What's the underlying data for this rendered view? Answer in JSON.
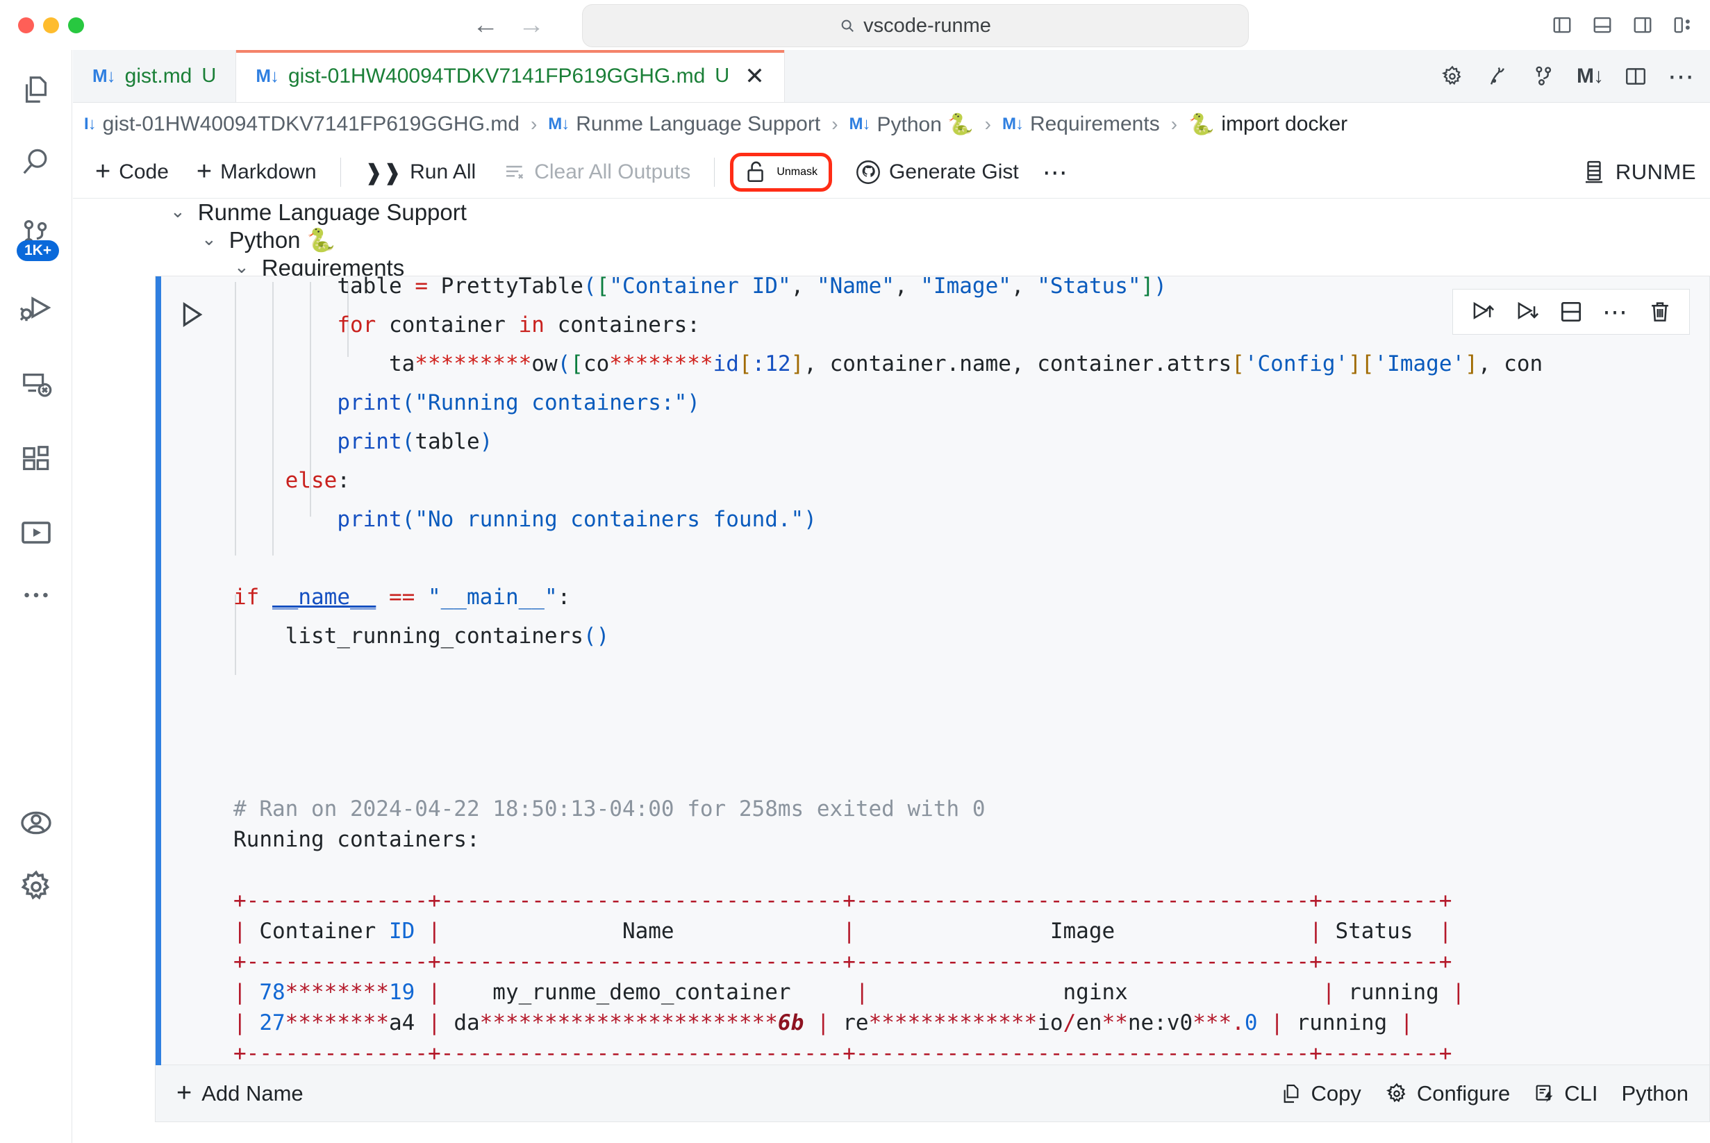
{
  "titlebar": {
    "omnibox_text": "vscode-runme",
    "back_label": "←",
    "forward_label": "→",
    "traffic": [
      "close",
      "minimize",
      "zoom"
    ],
    "layout_icons": [
      "toggle-primary-sidebar-icon",
      "toggle-panel-icon",
      "toggle-secondary-sidebar-icon",
      "customize-layout-icon"
    ]
  },
  "activitybar": {
    "items": [
      {
        "name": "explorer",
        "icon": "files-icon"
      },
      {
        "name": "search",
        "icon": "search-icon"
      },
      {
        "name": "source-control",
        "icon": "source-control-icon",
        "badge": "1K+"
      },
      {
        "name": "run-and-debug",
        "icon": "run-debug-icon"
      },
      {
        "name": "remote-explorer",
        "icon": "remote-explorer-icon"
      },
      {
        "name": "extensions",
        "icon": "extensions-icon"
      },
      {
        "name": "runme",
        "icon": "runme-play-icon"
      },
      {
        "name": "more-views",
        "icon": "ellipsis-icon"
      },
      {
        "name": "accounts",
        "icon": "account-icon"
      },
      {
        "name": "manage-settings",
        "icon": "gear-icon"
      }
    ]
  },
  "tabs": [
    {
      "label": "gist.md",
      "badge": "U",
      "icon": "markdown-icon",
      "active": false,
      "closable": false
    },
    {
      "label": "gist-01HW40094TDKV7141FP619GGHG.md",
      "badge": "U",
      "icon": "markdown-icon",
      "active": true,
      "closable": true
    }
  ],
  "tab_actions": [
    {
      "name": "settings-gear-icon"
    },
    {
      "name": "runme-mascot-icon"
    },
    {
      "name": "git-branch-icon"
    },
    {
      "name": "markdown-preview-icon"
    },
    {
      "name": "split-editor-icon"
    },
    {
      "name": "more-actions-icon"
    }
  ],
  "breadcrumb": {
    "items": [
      {
        "label": "gist-01HW40094TDKV7141FP619GGHG.md",
        "icon": "markdown-icon"
      },
      {
        "label": "Runme Language Support",
        "icon": "markdown-icon"
      },
      {
        "label": "Python 🐍",
        "icon": "markdown-icon"
      },
      {
        "label": "Requirements",
        "icon": "markdown-icon"
      },
      {
        "label": "import docker",
        "icon": "python-icon"
      }
    ],
    "separator": "›"
  },
  "notebook_toolbar": {
    "code_label": "Code",
    "markdown_label": "Markdown",
    "run_all_label": "Run All",
    "clear_all_outputs_label": "Clear All Outputs",
    "unmask_label": "Unmask",
    "unmask_highlighted": true,
    "generate_gist_label": "Generate Gist",
    "more_label": "⋯",
    "runme_label": "RUNME",
    "highlight_color": "#ff2d16"
  },
  "outline": {
    "h1": "Runme Language Support",
    "h2": "Python 🐍",
    "h3": "Requirements"
  },
  "cell": {
    "toolbar_icons": [
      "execute-above-icon",
      "execute-below-icon",
      "split-cell-icon",
      "more-cell-actions-icon",
      "delete-cell-icon"
    ],
    "run_icon": "run-cell-icon",
    "execution_brackets": "[ ]",
    "code_lines": [
      "table = PrettyTable([\"Container ID\", \"Name\", \"Image\", \"Status\"])",
      "        for container in containers:",
      "            ta*********ow([co********id[:12], container.name, container.attrs['Config']['Image'], con",
      "        print(\"Running containers:\")",
      "        print(table)",
      "    else:",
      "        print(\"No running containers found.\")",
      "",
      "if __name__ == \"__main__\":",
      "    list_running_containers()"
    ],
    "run_comment": "# Ran on 2024-04-22 18:50:13-04:00 for 258ms exited with 0",
    "output_heading": "Running containers:"
  },
  "output_table": {
    "headers": [
      "Container ID",
      "Name",
      "Image",
      "Status"
    ],
    "rows": [
      {
        "container_id": "78********19",
        "name": "my_runme_demo_container",
        "image": "nginx",
        "status": "running"
      },
      {
        "container_id": "27********a4",
        "name": "da***********************6b",
        "image": "re*************io/en**ne:v0***.0",
        "status": "running"
      }
    ],
    "border_color": "#b4192a"
  },
  "cell_footer": {
    "add_name_label": "Add Name",
    "copy_label": "Copy",
    "configure_label": "Configure",
    "cli_label": "CLI",
    "language_label": "Python"
  }
}
